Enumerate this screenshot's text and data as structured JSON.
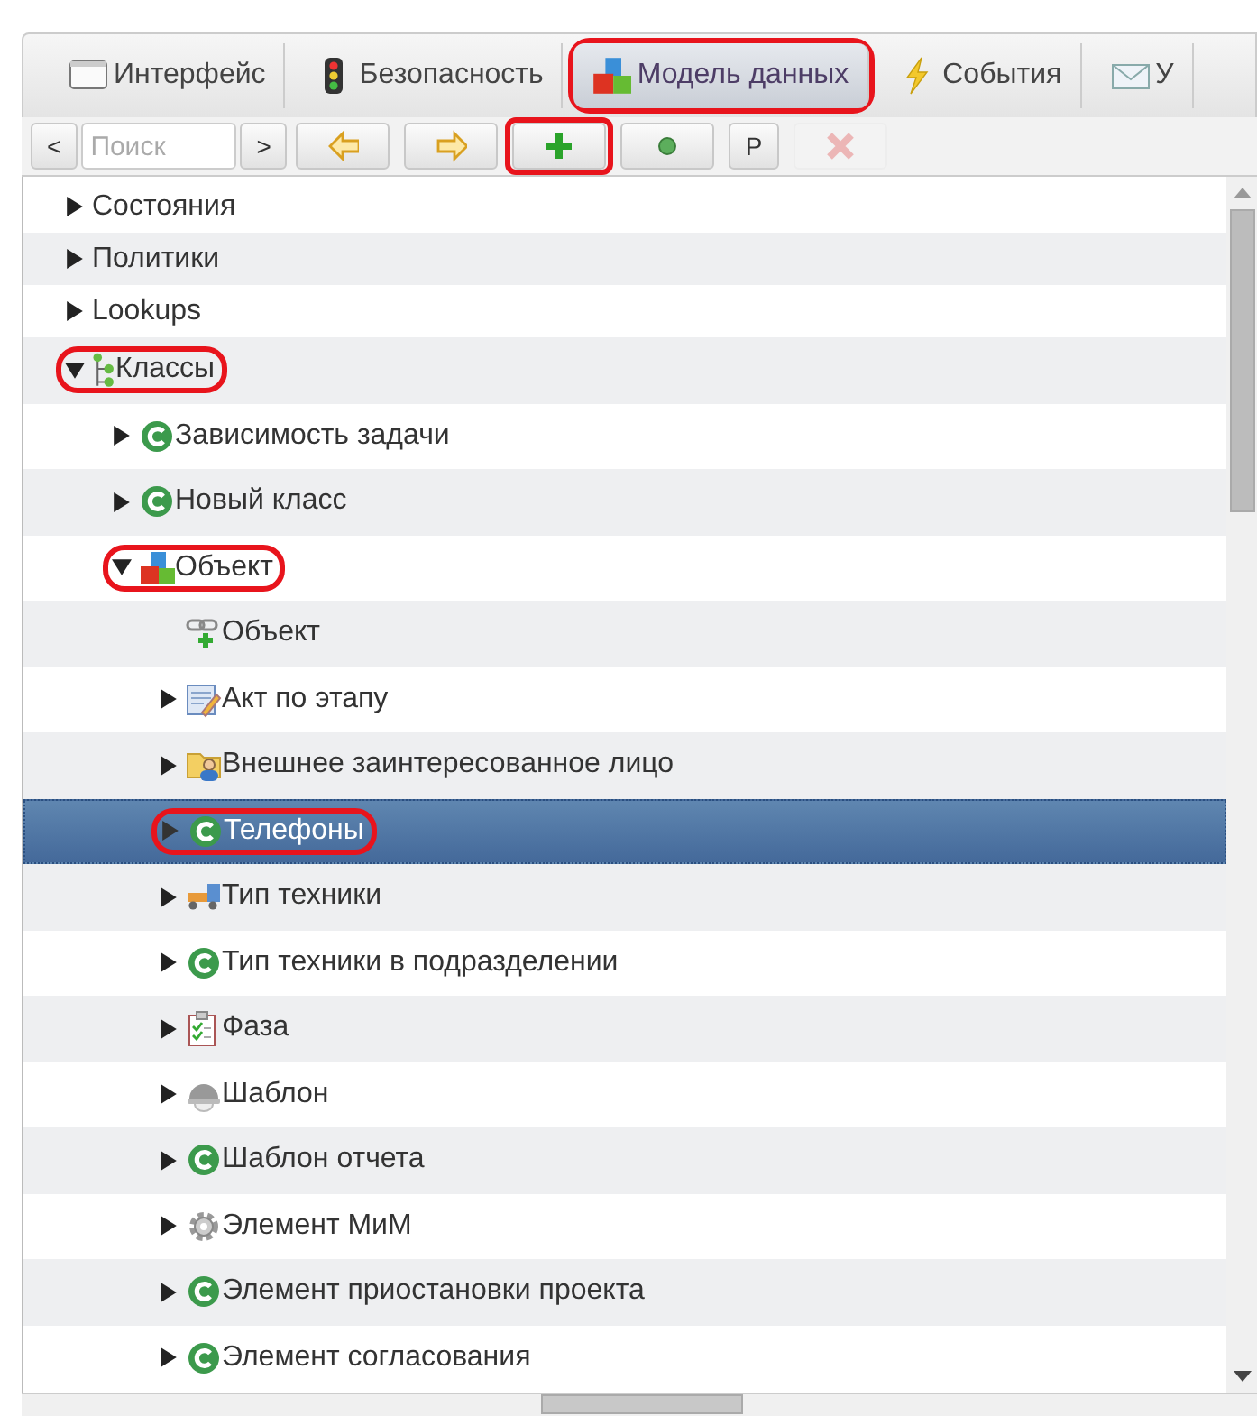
{
  "tabs": [
    {
      "label": "Интерфейс",
      "kind": "window",
      "selected": false,
      "highlighted": false
    },
    {
      "label": "Безопасность",
      "kind": "traffic",
      "selected": false,
      "highlighted": false
    },
    {
      "label": "Модель данных",
      "kind": "cubes",
      "selected": true,
      "highlighted": true
    },
    {
      "label": "События",
      "kind": "bolt",
      "selected": false,
      "highlighted": false
    },
    {
      "label": "У",
      "kind": "mail",
      "selected": false,
      "highlighted": false
    }
  ],
  "toolbar": {
    "prev": "<",
    "search": {
      "placeholder": "Поиск"
    },
    "next": ">",
    "buttons": [
      {
        "kind": "back",
        "disabled": false,
        "highlighted": false
      },
      {
        "kind": "forward",
        "disabled": false,
        "highlighted": false
      },
      {
        "kind": "add",
        "disabled": false,
        "highlighted": true
      },
      {
        "kind": "dot",
        "disabled": false,
        "highlighted": false
      },
      {
        "kind": "text",
        "label": "P",
        "disabled": false,
        "highlighted": false
      },
      {
        "kind": "delete",
        "disabled": true,
        "highlighted": false
      }
    ]
  },
  "tree": {
    "items": [
      {
        "label": "Состояния",
        "kind": "plain",
        "expanded": false,
        "selected": false,
        "highlighted": false
      },
      {
        "label": "Политики",
        "kind": "plain",
        "expanded": false,
        "selected": false,
        "highlighted": false
      },
      {
        "label": "Lookups",
        "kind": "plain",
        "expanded": false,
        "selected": false,
        "highlighted": false
      },
      {
        "label": "Классы",
        "kind": "hierarchy",
        "expanded": true,
        "selected": false,
        "highlighted": true,
        "children": [
          {
            "label": "Зависимость задачи",
            "kind": "class",
            "expanded": false,
            "selected": false,
            "highlighted": false
          },
          {
            "label": "Новый класс",
            "kind": "class",
            "expanded": false,
            "selected": false,
            "highlighted": false
          },
          {
            "label": "Объект",
            "kind": "cubes",
            "expanded": true,
            "selected": false,
            "highlighted": true,
            "children": [
              {
                "label": "Объект",
                "kind": "link",
                "selected": false,
                "highlighted": false
              },
              {
                "label": "Акт по этапу",
                "kind": "form",
                "expanded": false,
                "selected": false,
                "highlighted": false
              },
              {
                "label": "Внешнее заинтересованное лицо",
                "kind": "contact",
                "expanded": false,
                "selected": false,
                "highlighted": false
              },
              {
                "label": "Телефоны",
                "kind": "class",
                "expanded": false,
                "selected": true,
                "highlighted": true
              },
              {
                "label": "Тип техники",
                "kind": "vehicle",
                "expanded": false,
                "selected": false,
                "highlighted": false
              },
              {
                "label": "Тип техники в подразделении",
                "kind": "class",
                "expanded": false,
                "selected": false,
                "highlighted": false
              },
              {
                "label": "Фаза",
                "kind": "checklist",
                "expanded": false,
                "selected": false,
                "highlighted": false
              },
              {
                "label": "Шаблон",
                "kind": "helmet",
                "expanded": false,
                "selected": false,
                "highlighted": false
              },
              {
                "label": "Шаблон отчета",
                "kind": "class",
                "expanded": false,
                "selected": false,
                "highlighted": false
              },
              {
                "label": "Элемент МиМ",
                "kind": "gear",
                "expanded": false,
                "selected": false,
                "highlighted": false
              },
              {
                "label": "Элемент приостановки проекта",
                "kind": "class",
                "expanded": false,
                "selected": false,
                "highlighted": false
              },
              {
                "label": "Элемент согласования",
                "kind": "class",
                "expanded": false,
                "selected": false,
                "highlighted": false
              }
            ]
          }
        ]
      }
    ]
  }
}
